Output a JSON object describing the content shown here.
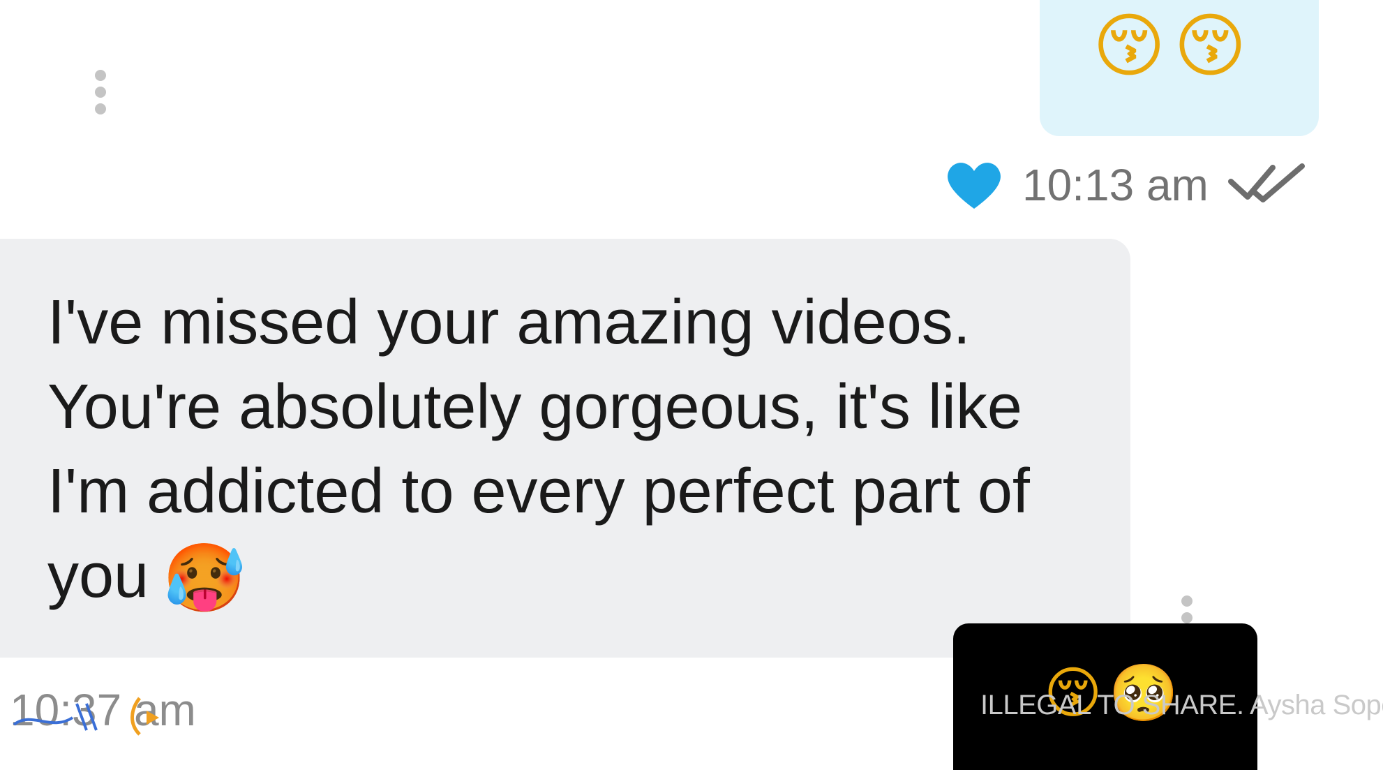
{
  "sent_message": {
    "emojis": [
      "😚",
      "😚"
    ],
    "reaction_icon": "blue-heart-icon",
    "time": "10:13 am",
    "status_icon": "double-check-icon"
  },
  "received_message": {
    "text": "I've missed your amazing videos. You're absolutely gorgeous, it's like I'm addicted to every perfect part of you",
    "emoji": "🥵",
    "time": "10:37 am"
  },
  "video_tile": {
    "emojis": [
      "😚",
      "🥺"
    ]
  },
  "watermark": "ILLEGAL TO SHARE. Aysha Soper",
  "colors": {
    "sent_bubble": "#dff4fb",
    "received_bubble": "#eeeff1",
    "heart": "#1fa6e6",
    "timestamp": "#727272"
  }
}
